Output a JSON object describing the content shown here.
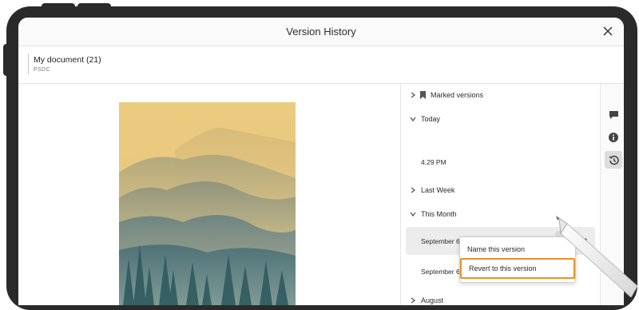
{
  "dialog": {
    "title": "Version History",
    "close_icon": "close-icon"
  },
  "document": {
    "name": "My document (21)",
    "type": "PSDC"
  },
  "versions": {
    "marked": "Marked versions",
    "today": "Today",
    "today_items": [
      "4.29 PM"
    ],
    "last_week": "Last Week",
    "this_month": "This Month",
    "this_month_items": [
      "September 6, 1:33 PM",
      "September 6"
    ],
    "august": "August"
  },
  "context_menu": {
    "name_version": "Name this version",
    "revert_version": "Revert to this version"
  },
  "rail": {
    "comments_icon": "comment-icon",
    "info_icon": "info-icon",
    "history_icon": "history-icon"
  },
  "colors": {
    "highlight": "#e8922a",
    "selected_row": "#ececec",
    "art_sky": "#e9c97a"
  }
}
